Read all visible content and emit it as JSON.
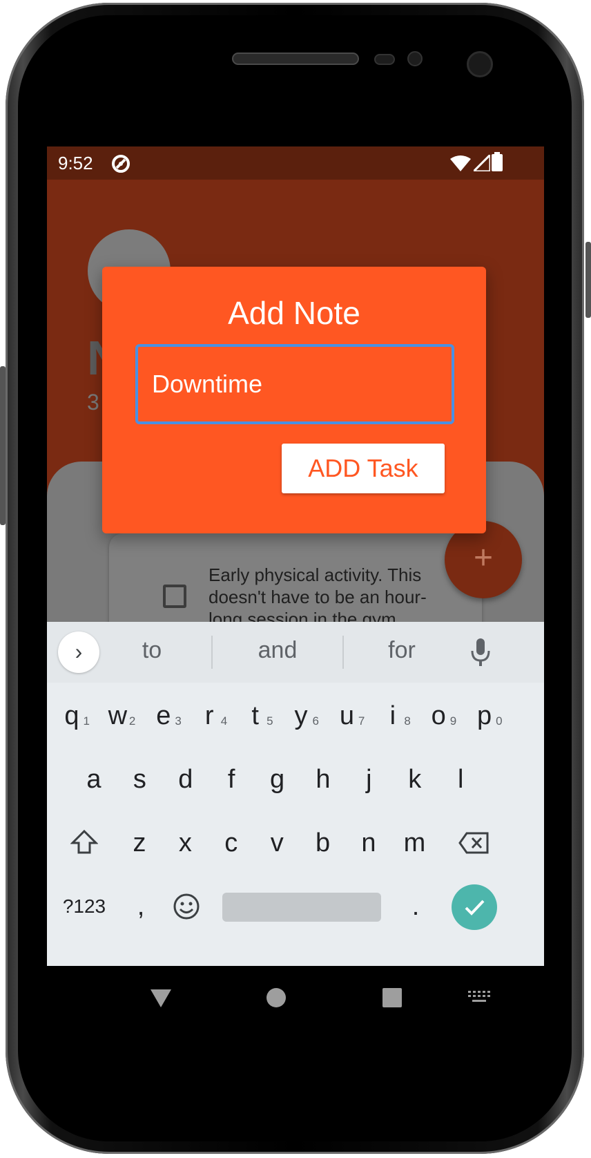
{
  "status_bar": {
    "time": "9:52"
  },
  "background_app": {
    "title_fragment": "N",
    "count_fragment": "3",
    "task": {
      "text": "Early physical activity. This doesn't have to be an hour-long session in the gym."
    },
    "fab_label": "+"
  },
  "dialog": {
    "title": "Add Note",
    "input_value": "Downtime",
    "button_label": "ADD Task"
  },
  "keyboard": {
    "suggestions": [
      "to",
      "and",
      "for"
    ],
    "row1": [
      {
        "key": "q",
        "hint": "1"
      },
      {
        "key": "w",
        "hint": "2"
      },
      {
        "key": "e",
        "hint": "3"
      },
      {
        "key": "r",
        "hint": "4"
      },
      {
        "key": "t",
        "hint": "5"
      },
      {
        "key": "y",
        "hint": "6"
      },
      {
        "key": "u",
        "hint": "7"
      },
      {
        "key": "i",
        "hint": "8"
      },
      {
        "key": "o",
        "hint": "9"
      },
      {
        "key": "p",
        "hint": "0"
      }
    ],
    "row2": [
      "a",
      "s",
      "d",
      "f",
      "g",
      "h",
      "j",
      "k",
      "l"
    ],
    "row3": [
      "z",
      "x",
      "c",
      "v",
      "b",
      "n",
      "m"
    ],
    "symbols_key": "?123",
    "comma_key": ",",
    "period_key": "."
  },
  "colors": {
    "dialog_bg": "#ff5722",
    "input_focus_border": "#4a90e2",
    "enter_key": "#4db6ac",
    "status_bar": "#5b200d"
  }
}
